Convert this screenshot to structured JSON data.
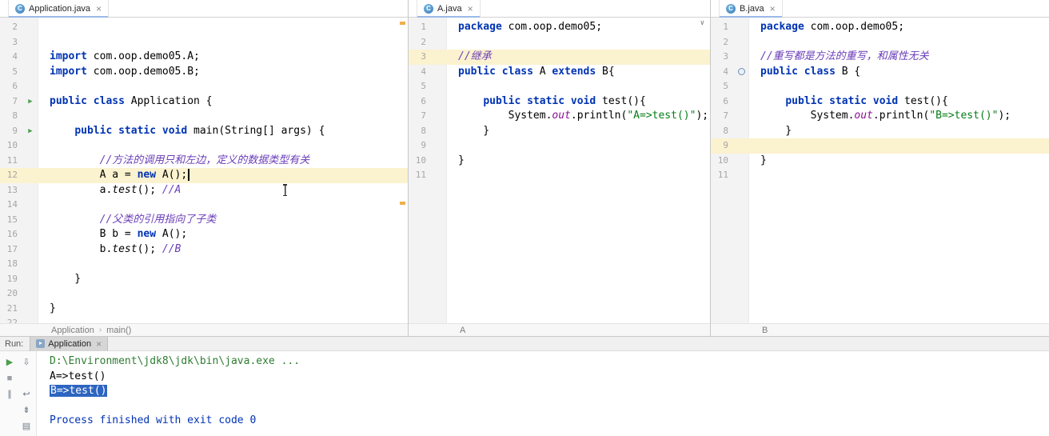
{
  "icons": {
    "class_letter": "C",
    "close": "×",
    "run": "▶",
    "chevron": "∨",
    "crumb_sep": "›"
  },
  "colors": {
    "keyword": "#0033b3",
    "comment": "#6a3db8",
    "string": "#067d17",
    "static_field": "#871094",
    "caret_line": "#fbf2cf",
    "selection": "#2d65c0",
    "run_icon_green": "#4d9f53",
    "stripe_mark_orange": "#eeb04d"
  },
  "panes": [
    {
      "tab": "Application.java",
      "breadcrumb": [
        "Application",
        "main()"
      ],
      "lines": [
        {
          "n": 2,
          "s": []
        },
        {
          "n": 3,
          "s": []
        },
        {
          "n": 4,
          "s": [
            [
              "kw",
              "import"
            ],
            [
              "pln",
              " com.oop.demo05.A;"
            ]
          ]
        },
        {
          "n": 5,
          "s": [
            [
              "kw",
              "import"
            ],
            [
              "pln",
              " com.oop.demo05.B;"
            ]
          ]
        },
        {
          "n": 6,
          "s": []
        },
        {
          "n": 7,
          "icon": "run",
          "s": [
            [
              "kw",
              "public class"
            ],
            [
              "pln",
              " Application {"
            ]
          ]
        },
        {
          "n": 8,
          "s": []
        },
        {
          "n": 9,
          "icon": "run",
          "s": [
            [
              "pln",
              "    "
            ],
            [
              "kw",
              "public static void"
            ],
            [
              "pln",
              " main(String[] args) {"
            ]
          ]
        },
        {
          "n": 10,
          "s": []
        },
        {
          "n": 11,
          "s": [
            [
              "pln",
              "        "
            ],
            [
              "cmt",
              "//方法的调用只和左边，定义的数据类型有关"
            ]
          ]
        },
        {
          "n": 12,
          "hl": true,
          "caret": true,
          "s": [
            [
              "pln",
              "        A a = "
            ],
            [
              "kw",
              "new"
            ],
            [
              "pln",
              " A();"
            ]
          ]
        },
        {
          "n": 13,
          "s": [
            [
              "pln",
              "        a."
            ],
            [
              "itl",
              "test"
            ],
            [
              "pln",
              "(); "
            ],
            [
              "cmt",
              "//A"
            ]
          ]
        },
        {
          "n": 14,
          "s": []
        },
        {
          "n": 15,
          "s": [
            [
              "pln",
              "        "
            ],
            [
              "cmt",
              "//父类的引用指向了子类"
            ]
          ]
        },
        {
          "n": 16,
          "s": [
            [
              "pln",
              "        B b = "
            ],
            [
              "kw",
              "new"
            ],
            [
              "pln",
              " A();"
            ]
          ]
        },
        {
          "n": 17,
          "s": [
            [
              "pln",
              "        b."
            ],
            [
              "itl",
              "test"
            ],
            [
              "pln",
              "(); "
            ],
            [
              "cmt",
              "//B"
            ]
          ]
        },
        {
          "n": 18,
          "s": []
        },
        {
          "n": 19,
          "s": [
            [
              "pln",
              "    }"
            ]
          ]
        },
        {
          "n": 20,
          "s": []
        },
        {
          "n": 21,
          "s": [
            [
              "pln",
              "}"
            ]
          ]
        },
        {
          "n": 22,
          "s": []
        }
      ]
    },
    {
      "tab": "A.java",
      "chevron": "∨",
      "breadcrumb": [
        "A"
      ],
      "lines": [
        {
          "n": 1,
          "s": [
            [
              "kw",
              "package"
            ],
            [
              "pln",
              " com.oop.demo05;"
            ]
          ]
        },
        {
          "n": 2,
          "s": []
        },
        {
          "n": 3,
          "hl": true,
          "s": [
            [
              "cmt",
              "//继承"
            ]
          ]
        },
        {
          "n": 4,
          "s": [
            [
              "kw",
              "public class"
            ],
            [
              "pln",
              " A "
            ],
            [
              "kw",
              "extends"
            ],
            [
              "pln",
              " B{"
            ]
          ]
        },
        {
          "n": 5,
          "s": []
        },
        {
          "n": 6,
          "s": [
            [
              "pln",
              "    "
            ],
            [
              "kw",
              "public static void"
            ],
            [
              "pln",
              " test(){"
            ]
          ]
        },
        {
          "n": 7,
          "s": [
            [
              "pln",
              "        System."
            ],
            [
              "fld",
              "out"
            ],
            [
              "pln",
              ".println("
            ],
            [
              "str",
              "\"A=>test()\""
            ],
            [
              "pln",
              ");"
            ]
          ]
        },
        {
          "n": 8,
          "s": [
            [
              "pln",
              "    }"
            ]
          ]
        },
        {
          "n": 9,
          "s": []
        },
        {
          "n": 10,
          "s": [
            [
              "pln",
              "}"
            ]
          ]
        },
        {
          "n": 11,
          "s": []
        }
      ]
    },
    {
      "tab": "B.java",
      "breadcrumb": [
        "B"
      ],
      "lines": [
        {
          "n": 1,
          "s": [
            [
              "kw",
              "package"
            ],
            [
              "pln",
              " com.oop.demo05;"
            ]
          ]
        },
        {
          "n": 2,
          "s": []
        },
        {
          "n": 3,
          "s": [
            [
              "cmt",
              "//重写都是方法的重写，和属性无关"
            ]
          ]
        },
        {
          "n": 4,
          "icon": "sub",
          "s": [
            [
              "kw",
              "public class"
            ],
            [
              "pln",
              " B {"
            ]
          ]
        },
        {
          "n": 5,
          "s": []
        },
        {
          "n": 6,
          "s": [
            [
              "pln",
              "    "
            ],
            [
              "kw",
              "public static void"
            ],
            [
              "pln",
              " test(){"
            ]
          ]
        },
        {
          "n": 7,
          "s": [
            [
              "pln",
              "        System."
            ],
            [
              "fld",
              "out"
            ],
            [
              "pln",
              ".println("
            ],
            [
              "str",
              "\"B=>test()\""
            ],
            [
              "pln",
              ");"
            ]
          ]
        },
        {
          "n": 8,
          "s": [
            [
              "pln",
              "    }"
            ]
          ]
        },
        {
          "n": 9,
          "hl": true,
          "s": []
        },
        {
          "n": 10,
          "s": [
            [
              "pln",
              "}"
            ]
          ]
        },
        {
          "n": 11,
          "s": []
        }
      ]
    }
  ],
  "run": {
    "label": "Run:",
    "tab": "Application",
    "toolbar": [
      {
        "name": "rerun",
        "glyph": "▶",
        "color": "#4c9e4c"
      },
      {
        "name": "down-the-stack-trace",
        "glyph": "⇩"
      },
      {
        "name": "stop",
        "glyph": "■",
        "color": "#9aa0a6"
      },
      {
        "name": "",
        "glyph": ""
      },
      {
        "name": "pause-output",
        "glyph": "∥"
      },
      {
        "name": "soft-wrap",
        "glyph": "↩"
      },
      {
        "name": "",
        "glyph": ""
      },
      {
        "name": "scroll-to-end",
        "glyph": "⇟"
      },
      {
        "name": "",
        "glyph": ""
      },
      {
        "name": "clear-all",
        "glyph": "▤"
      }
    ],
    "console": [
      {
        "type": "cmd",
        "text": "D:\\Environment\\jdk8\\jdk\\bin\\java.exe ..."
      },
      {
        "type": "out",
        "text": "A=>test()"
      },
      {
        "type": "sel",
        "text": "B=>test()"
      },
      {
        "type": "blank",
        "text": ""
      },
      {
        "type": "info",
        "text": "Process finished with exit code 0"
      }
    ]
  }
}
